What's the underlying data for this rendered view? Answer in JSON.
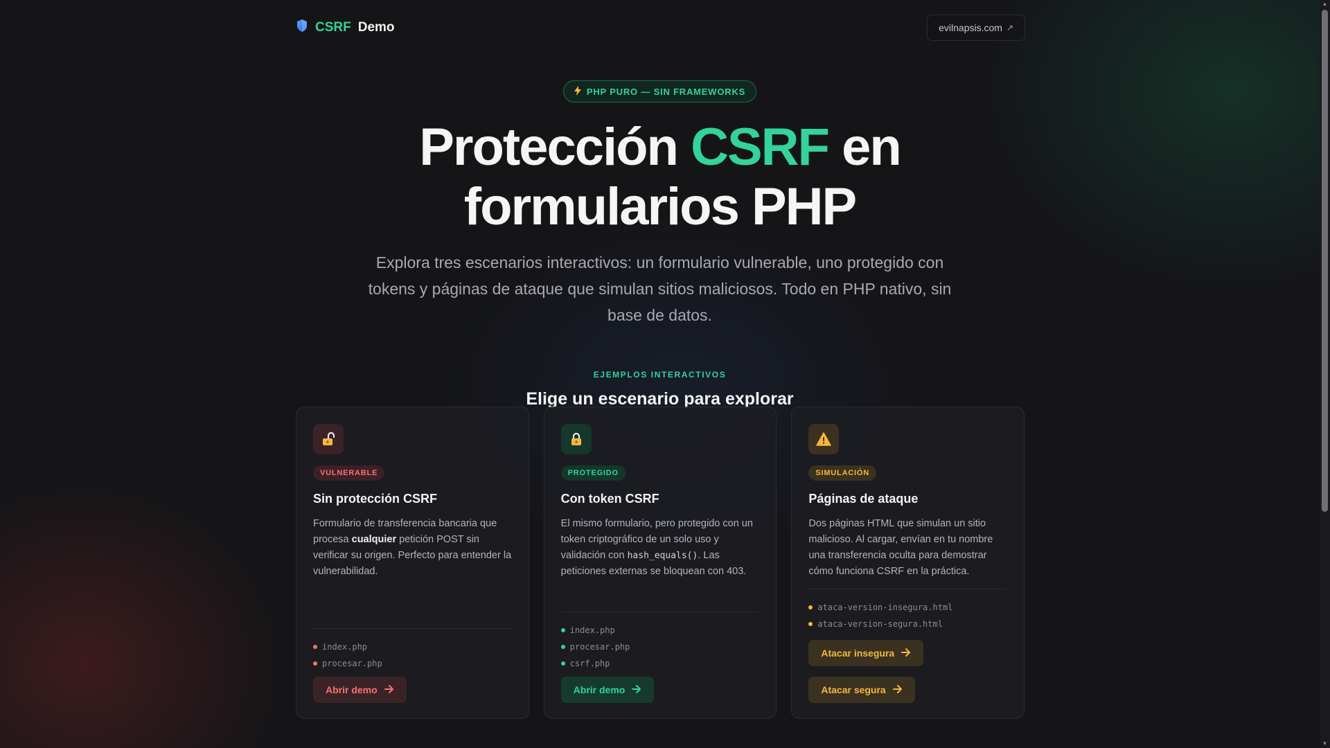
{
  "header": {
    "brand_accent": "CSRF",
    "brand_rest": "Demo",
    "brand_icon": "shield-icon",
    "ext_link": "evilnapsis.com",
    "ext_link_icon": "external-arrow-icon"
  },
  "hero": {
    "pill_icon": "bolt-icon",
    "pill": "PHP PURO — SIN FRAMEWORKS",
    "title_part1": "Protección ",
    "title_accent": "CSRF",
    "title_part2": " en",
    "title_line2": "formularios PHP",
    "subtitle": "Explora tres escenarios interactivos: un formulario vulnerable, uno protegido con tokens y páginas de ataque que simulan sitios maliciosos. Todo en PHP nativo, sin base de datos."
  },
  "section": {
    "eyebrow": "EJEMPLOS INTERACTIVOS",
    "title": "Elige un escenario para explorar"
  },
  "cards": [
    {
      "icon": "unlocked-padlock-icon",
      "badge": "VULNERABLE",
      "title": "Sin protección CSRF",
      "desc_1": "Formulario de transferencia bancaria que procesa ",
      "desc_bold": "cualquier",
      "desc_2": " petición POST sin verificar su origen. Perfecto para entender la vulnerabilidad.",
      "files": [
        "index.php",
        "procesar.php"
      ],
      "button": "Abrir demo"
    },
    {
      "icon": "locked-padlock-icon",
      "badge": "PROTEGIDO",
      "title": "Con token CSRF",
      "desc_1": "El mismo formulario, pero protegido con un token criptográfico de un solo uso y validación con ",
      "desc_code": "hash_equals()",
      "desc_2": ". Las peticiones externas se bloquean con 403.",
      "files": [
        "index.php",
        "procesar.php",
        "csrf.php"
      ],
      "button": "Abrir demo"
    },
    {
      "icon": "warning-icon",
      "badge": "SIMULACIÓN",
      "title": "Páginas de ataque",
      "desc": "Dos páginas HTML que simulan un sitio malicioso. Al cargar, envían en tu nombre una transferencia oculta para demostrar cómo funciona CSRF en la práctica.",
      "files": [
        "ataca-version-insegura.html",
        "ataca-version-segura.html"
      ],
      "button_1": "Atacar insegura",
      "button_2": "Atacar segura"
    }
  ],
  "colors": {
    "background": "#151518",
    "accent_green": "#34d399",
    "accent_red": "#f87171",
    "accent_amber": "#f5b83d"
  }
}
